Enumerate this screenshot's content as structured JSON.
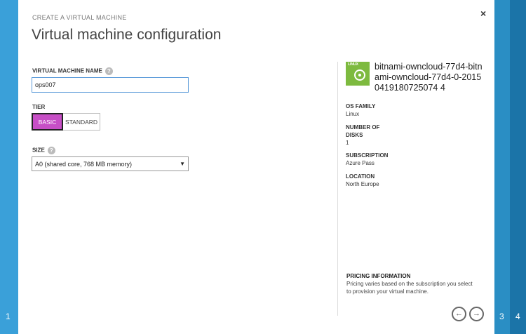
{
  "wizard": {
    "overline": "CREATE A VIRTUAL MACHINE",
    "title": "Virtual machine configuration",
    "close_glyph": "×",
    "steps": {
      "left": "1",
      "right_a": "3",
      "right_b": "4"
    }
  },
  "form": {
    "vm_name_label": "VIRTUAL MACHINE NAME",
    "vm_name_value": "ops007",
    "help_glyph": "?",
    "tier_label": "TIER",
    "tier_options": [
      "BASIC",
      "STANDARD"
    ],
    "tier_selected": "BASIC",
    "size_label": "SIZE",
    "size_value": "A0 (shared core, 768 MB memory)"
  },
  "summary": {
    "os_badge": "LINUX",
    "image_name": "bitnami-owncloud-77d4-bitnami-owncloud-77d4-0-20150419180725074 4",
    "os_family_label": "OS FAMILY",
    "os_family_value": "Linux",
    "disks_label": "NUMBER OF DISKS",
    "disks_value": "1",
    "subscription_label": "SUBSCRIPTION",
    "subscription_value": "Azure Pass",
    "location_label": "LOCATION",
    "location_value": "North Europe",
    "pricing_label": "PRICING INFORMATION",
    "pricing_text": "Pricing varies based on the subscription you select to provision your virtual machine."
  },
  "nav": {
    "prev_glyph": "←",
    "next_glyph": "→"
  },
  "colors": {
    "accent": "#3aa0d9",
    "tier_selected": "#c74fc6",
    "linux_badge": "#7dba3f"
  },
  "icons": {
    "close": "close-icon",
    "help": "help-icon",
    "disk": "disk-icon",
    "prev": "arrow-left-icon",
    "next": "arrow-right-icon"
  }
}
